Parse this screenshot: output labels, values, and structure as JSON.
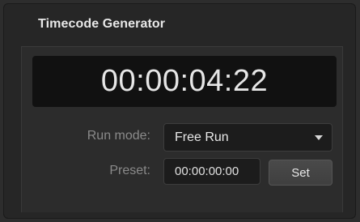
{
  "panel": {
    "title": "Timecode Generator"
  },
  "timecode": {
    "display": "00:00:04:22"
  },
  "run_mode": {
    "label": "Run mode:",
    "selected": "Free Run"
  },
  "preset": {
    "label": "Preset:",
    "value": "00:00:00:00",
    "set_label": "Set"
  },
  "colors": {
    "background": "#2d2d2d",
    "display_background": "#111111",
    "label_text": "#8a8a8a",
    "value_text": "#e8e8e8"
  }
}
